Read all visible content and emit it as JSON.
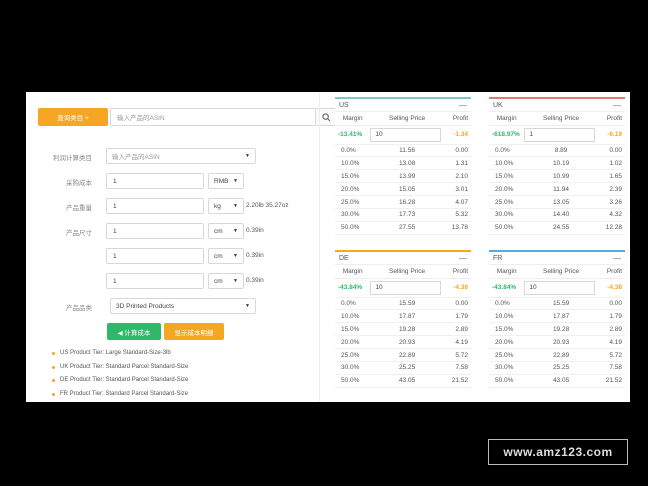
{
  "left": {
    "query_button": "查询类目 +",
    "asin_placeholder": "输入产品的ASIN",
    "category_label": "利润计算类目",
    "category_placeholder": "输入产品的ASIN",
    "cost_label": "采购成本",
    "cost_value": "1",
    "cost_unit": "RMB",
    "weight_label": "产品重量",
    "weight_value": "1",
    "weight_unit": "kg",
    "weight_conv": "2.20lb 35.27oz",
    "size_label": "产品尺寸",
    "dims": [
      {
        "value": "1",
        "unit": "cm",
        "conv": "0.39in"
      },
      {
        "value": "1",
        "unit": "cm",
        "conv": "0.39in"
      },
      {
        "value": "1",
        "unit": "cm",
        "conv": "0.39in"
      }
    ],
    "type_label": "产品品类",
    "type_value": "3D Printed Products",
    "calc_button": "◀ 计算成本",
    "detail_button": "显示成本明细",
    "tiers": [
      "US Product Tier: Large Standard-Size-3lb",
      "UK Product Tier: Standard Parcel Standard-Size",
      "DE Product Tier: Standard Parcel Standard-Size",
      "FR Product Tier: Standard Parcel Standard-Size"
    ]
  },
  "markets": [
    {
      "code": "US",
      "color": "#7ec8c8",
      "collapse": "—",
      "headers": [
        "Margin",
        "Selling Price",
        "Profit"
      ],
      "input_margin": "-13.41%",
      "input_margin_color": "green",
      "input_price": "10",
      "input_profit": "-1.34",
      "rows": [
        [
          "0.0%",
          "11.56",
          "0.00"
        ],
        [
          "10.0%",
          "13.08",
          "1.31"
        ],
        [
          "15.0%",
          "13.99",
          "2.10"
        ],
        [
          "20.0%",
          "15.05",
          "3.01"
        ],
        [
          "25.0%",
          "16.28",
          "4.07"
        ],
        [
          "30.0%",
          "17.73",
          "5.32"
        ],
        [
          "50.0%",
          "27.55",
          "13.78"
        ]
      ]
    },
    {
      "code": "UK",
      "color": "#e07a7a",
      "collapse": "—",
      "headers": [
        "Margin",
        "Selling Price",
        "Profit"
      ],
      "input_margin": "-618.97%",
      "input_margin_color": "green",
      "input_price": "1",
      "input_profit": "-6.19",
      "rows": [
        [
          "0.0%",
          "8.89",
          "0.00"
        ],
        [
          "10.0%",
          "10.19",
          "1.02"
        ],
        [
          "15.0%",
          "10.99",
          "1.65"
        ],
        [
          "20.0%",
          "11.94",
          "2.39"
        ],
        [
          "25.0%",
          "13.05",
          "3.26"
        ],
        [
          "30.0%",
          "14.40",
          "4.32"
        ],
        [
          "50.0%",
          "24.55",
          "12.28"
        ]
      ]
    },
    {
      "code": "DE",
      "color": "#f5a623",
      "collapse": "—",
      "headers": [
        "Margin",
        "Selling Price",
        "Profit"
      ],
      "input_margin": "-43.84%",
      "input_margin_color": "green",
      "input_price": "10",
      "input_profit": "-4.38",
      "rows": [
        [
          "0.0%",
          "15.59",
          "0.00"
        ],
        [
          "10.0%",
          "17.87",
          "1.79"
        ],
        [
          "15.0%",
          "19.28",
          "2.89"
        ],
        [
          "20.0%",
          "20.93",
          "4.19"
        ],
        [
          "25.0%",
          "22.89",
          "5.72"
        ],
        [
          "30.0%",
          "25.25",
          "7.58"
        ],
        [
          "50.0%",
          "43.05",
          "21.52"
        ]
      ]
    },
    {
      "code": "FR",
      "color": "#5aa8e0",
      "collapse": "—",
      "headers": [
        "Margin",
        "Selling Price",
        "Profit"
      ],
      "input_margin": "-43.84%",
      "input_margin_color": "green",
      "input_price": "10",
      "input_profit": "-4.38",
      "rows": [
        [
          "0.0%",
          "15.59",
          "0.00"
        ],
        [
          "10.0%",
          "17.87",
          "1.79"
        ],
        [
          "15.0%",
          "19.28",
          "2.89"
        ],
        [
          "20.0%",
          "20.93",
          "4.19"
        ],
        [
          "25.0%",
          "22.89",
          "5.72"
        ],
        [
          "30.0%",
          "25.25",
          "7.58"
        ],
        [
          "50.0%",
          "43.05",
          "21.52"
        ]
      ]
    }
  ],
  "watermark": "www.amz123.com"
}
